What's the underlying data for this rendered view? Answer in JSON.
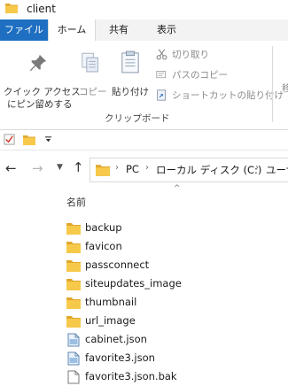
{
  "window": {
    "title": "client"
  },
  "tabs": [
    "ファイル",
    "ホーム",
    "共有",
    "表示"
  ],
  "ribbon": {
    "pin_label_line1": "クイック アクセス",
    "pin_label_line2": "にピン留めする",
    "copy_label": "コピー",
    "paste_label": "貼り付け",
    "cut_label": "切り取り",
    "copy_path_label": "パスのコピー",
    "paste_shortcut_label": "ショートカットの貼り付け",
    "group_label": "クリップボード",
    "cut_off_text": "移"
  },
  "address": {
    "crumbs": [
      "PC",
      "ローカル ディスク (C:)",
      "ユーザ"
    ]
  },
  "list": {
    "column_name": "名前",
    "items": [
      {
        "name": "backup",
        "type": "folder"
      },
      {
        "name": "favicon",
        "type": "folder"
      },
      {
        "name": "passconnect",
        "type": "folder"
      },
      {
        "name": "siteupdates_image",
        "type": "folder"
      },
      {
        "name": "thumbnail",
        "type": "folder"
      },
      {
        "name": "url_image",
        "type": "folder"
      },
      {
        "name": "cabinet.json",
        "type": "json"
      },
      {
        "name": "favorite3.json",
        "type": "json"
      },
      {
        "name": "favorite3.json.bak",
        "type": "file"
      }
    ]
  },
  "colors": {
    "file_tab": "#1e6fc1",
    "folder_yellow": "#f6c94a",
    "folder_dark": "#e0a82e"
  }
}
